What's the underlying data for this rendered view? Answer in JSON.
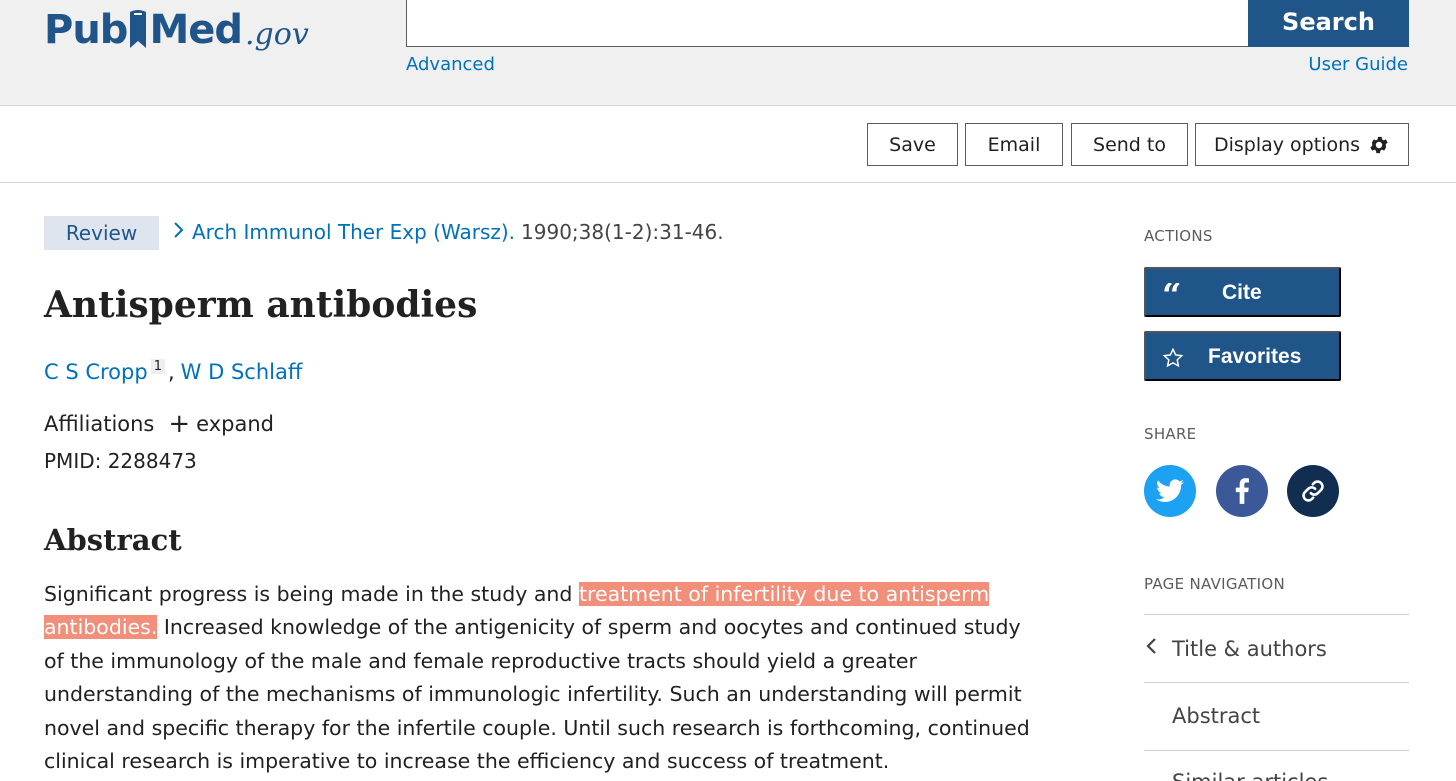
{
  "header": {
    "logo_left": "Pub",
    "logo_right": "Med",
    "logo_suffix": ".gov",
    "search": {
      "value": "",
      "placeholder": "",
      "button_label": "Search"
    },
    "advanced_label": "Advanced",
    "user_guide_label": "User Guide"
  },
  "toolbar": {
    "save_label": "Save",
    "email_label": "Email",
    "send_to_label": "Send to",
    "display_options_label": "Display options"
  },
  "article": {
    "type_badge": "Review",
    "journal": "Arch Immunol Ther Exp (Warsz).",
    "citation": "1990;38(1-2):31-46.",
    "title": "Antisperm antibodies",
    "authors": [
      {
        "name": "C S Cropp",
        "affiliation_ref": "1"
      },
      {
        "name": "W D Schlaff"
      }
    ],
    "author_separator": ",",
    "affiliations_label": "Affiliations",
    "expand_label": "expand",
    "pmid": "PMID: 2288473",
    "abstract_heading": "Abstract",
    "abstract_before": "Significant progress is being made in the study and ",
    "abstract_highlight": "treatment of infertility due to antisperm antibodies.",
    "abstract_after": " Increased knowledge of the antigenicity of sperm and oocytes and continued study of the immunology of the male and female reproductive tracts should yield a greater understanding of the mechanisms of immunologic infertility. Such an understanding will permit novel and specific therapy for the infertile couple. Until such research is forthcoming, continued clinical research is imperative to increase the efficiency and success of treatment.",
    "highlight_color": "#f28f7a"
  },
  "sidebar": {
    "actions_label": "ACTIONS",
    "cite_label": "Cite",
    "favorites_label": "Favorites",
    "share_label": "SHARE",
    "share_icons": [
      "twitter-icon",
      "facebook-icon",
      "link-icon"
    ],
    "page_nav_label": "PAGE NAVIGATION",
    "nav_items": [
      {
        "label": "Title & authors",
        "current": true
      },
      {
        "label": "Abstract"
      },
      {
        "label": "Similar articles"
      }
    ]
  },
  "colors": {
    "brand": "#20558a",
    "link": "#0071bc",
    "twitter": "#1da1f2",
    "facebook": "#3b5998",
    "permalink": "#112e51"
  }
}
